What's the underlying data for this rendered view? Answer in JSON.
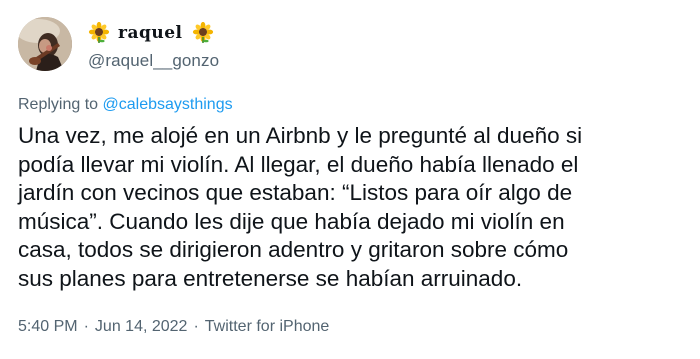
{
  "author": {
    "display_name": "raquel",
    "handle": "@raquel__gonzo",
    "name_emoji": "sunflower-icon",
    "avatar": "avatar-photo"
  },
  "reply": {
    "prefix": "Replying to ",
    "to": "@calebsaysthings"
  },
  "body_lines": [
    "Una vez, me alojé en un Airbnb y le pregunté al dueño si",
    "podía llevar mi violín. Al llegar, el dueño había llenado el",
    "jardín con vecinos que estaban: “Listos para oír algo de",
    "música”. Cuando les dije que había dejado mi violín en",
    "casa, todos se dirigieron adentro y gritaron sobre cómo",
    "sus planes para entretenerse se habían arruinado."
  ],
  "meta": {
    "time": "5:40 PM",
    "separator": "·",
    "date": "Jun 14, 2022",
    "source": "Twitter for iPhone"
  },
  "colors": {
    "text": "#0f1419",
    "muted": "#536471",
    "link": "#1d9bf0"
  }
}
